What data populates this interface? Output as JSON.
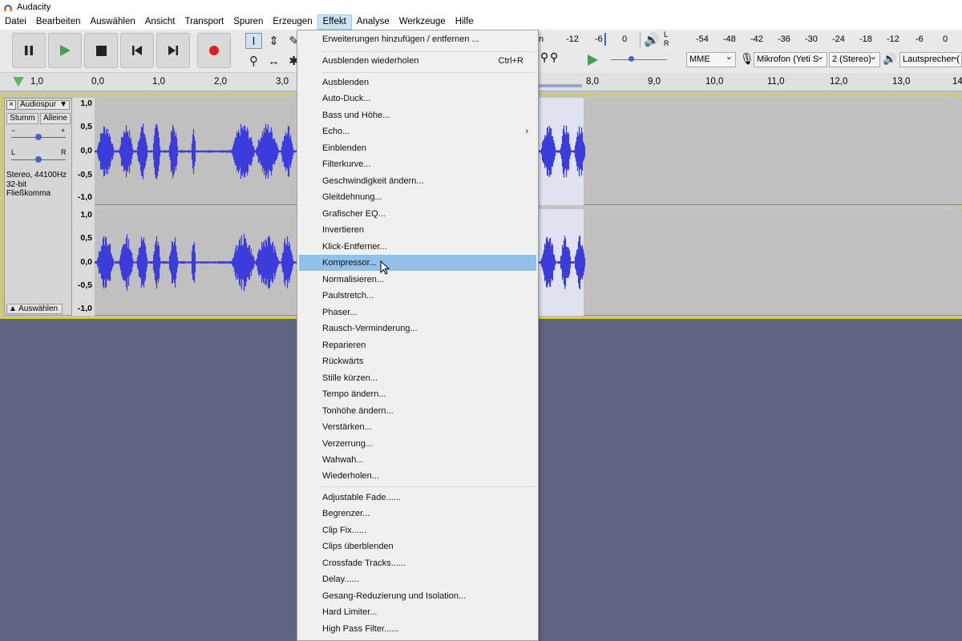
{
  "window": {
    "title": "Audacity"
  },
  "menubar": {
    "items": [
      "Datei",
      "Bearbeiten",
      "Auswählen",
      "Ansicht",
      "Transport",
      "Spuren",
      "Erzeugen",
      "Effekt",
      "Analyse",
      "Werkzeuge",
      "Hilfe"
    ],
    "active": "Effekt"
  },
  "meters": {
    "playback_ticks": [
      "-12",
      "-6",
      "0"
    ],
    "record_lr": [
      "L",
      "R"
    ],
    "record_ticks": [
      "-54",
      "-48",
      "-42",
      "-36",
      "-30",
      "-24",
      "-18",
      "-12",
      "-6",
      "0"
    ],
    "host": "MME",
    "mic": "Mikrofon (Yeti S",
    "channels": "2 (Stereo)",
    "speaker": "Lautsprecher ("
  },
  "ruler": {
    "ticks": [
      "1,0",
      "0,0",
      "1,0",
      "2,0",
      "3,0",
      "8,0",
      "9,0",
      "10,0",
      "11,0",
      "12,0",
      "13,0",
      "14"
    ]
  },
  "track": {
    "name": "Audiospur",
    "mute": "Stumm",
    "solo": "Alleine",
    "gain_minus": "−",
    "gain_plus": "+",
    "pan_l": "L",
    "pan_r": "R",
    "info1": "Stereo, 44100Hz",
    "info2": "32-bit Fließkomma",
    "select": "Auswählen",
    "scale": [
      "1,0",
      "0,5",
      "0,0",
      "-0,5",
      "-1,0"
    ]
  },
  "waveform_color": "#3c3cdc",
  "effect_menu": {
    "top": [
      {
        "label": "Erweiterungen hinzufügen / entfernen ..."
      },
      {
        "label": "Ausblenden wiederholen",
        "shortcut": "Ctrl+R"
      }
    ],
    "builtin": [
      {
        "label": "Ausblenden"
      },
      {
        "label": "Auto-Duck..."
      },
      {
        "label": "Bass und Höhe..."
      },
      {
        "label": "Echo...",
        "arrow": "›"
      },
      {
        "label": "Einblenden"
      },
      {
        "label": "Filterkurve..."
      },
      {
        "label": "Geschwindigkeit ändern..."
      },
      {
        "label": "Gleitdehnung..."
      },
      {
        "label": "Grafischer EQ..."
      },
      {
        "label": "Invertieren"
      },
      {
        "label": "Klick-Entferner..."
      },
      {
        "label": "Kompressor...",
        "highlighted": true
      },
      {
        "label": "Normalisieren..."
      },
      {
        "label": "Paulstretch..."
      },
      {
        "label": "Phaser..."
      },
      {
        "label": "Rausch-Verminderung..."
      },
      {
        "label": "Reparieren"
      },
      {
        "label": "Rückwärts"
      },
      {
        "label": "Stille kürzen..."
      },
      {
        "label": "Tempo ändern..."
      },
      {
        "label": "Tonhöhe ändern..."
      },
      {
        "label": "Verstärken..."
      },
      {
        "label": "Verzerrung..."
      },
      {
        "label": "Wahwah..."
      },
      {
        "label": "Wiederholen..."
      }
    ],
    "plugins": [
      {
        "label": "Adjustable Fade......"
      },
      {
        "label": "Begrenzer..."
      },
      {
        "label": "Clip Fix......"
      },
      {
        "label": "Clips überblenden"
      },
      {
        "label": "Crossfade Tracks......"
      },
      {
        "label": "Delay......"
      },
      {
        "label": "Gesang-Reduzierung und Isolation..."
      },
      {
        "label": "Hard Limiter..."
      },
      {
        "label": "High Pass Filter......"
      }
    ]
  }
}
